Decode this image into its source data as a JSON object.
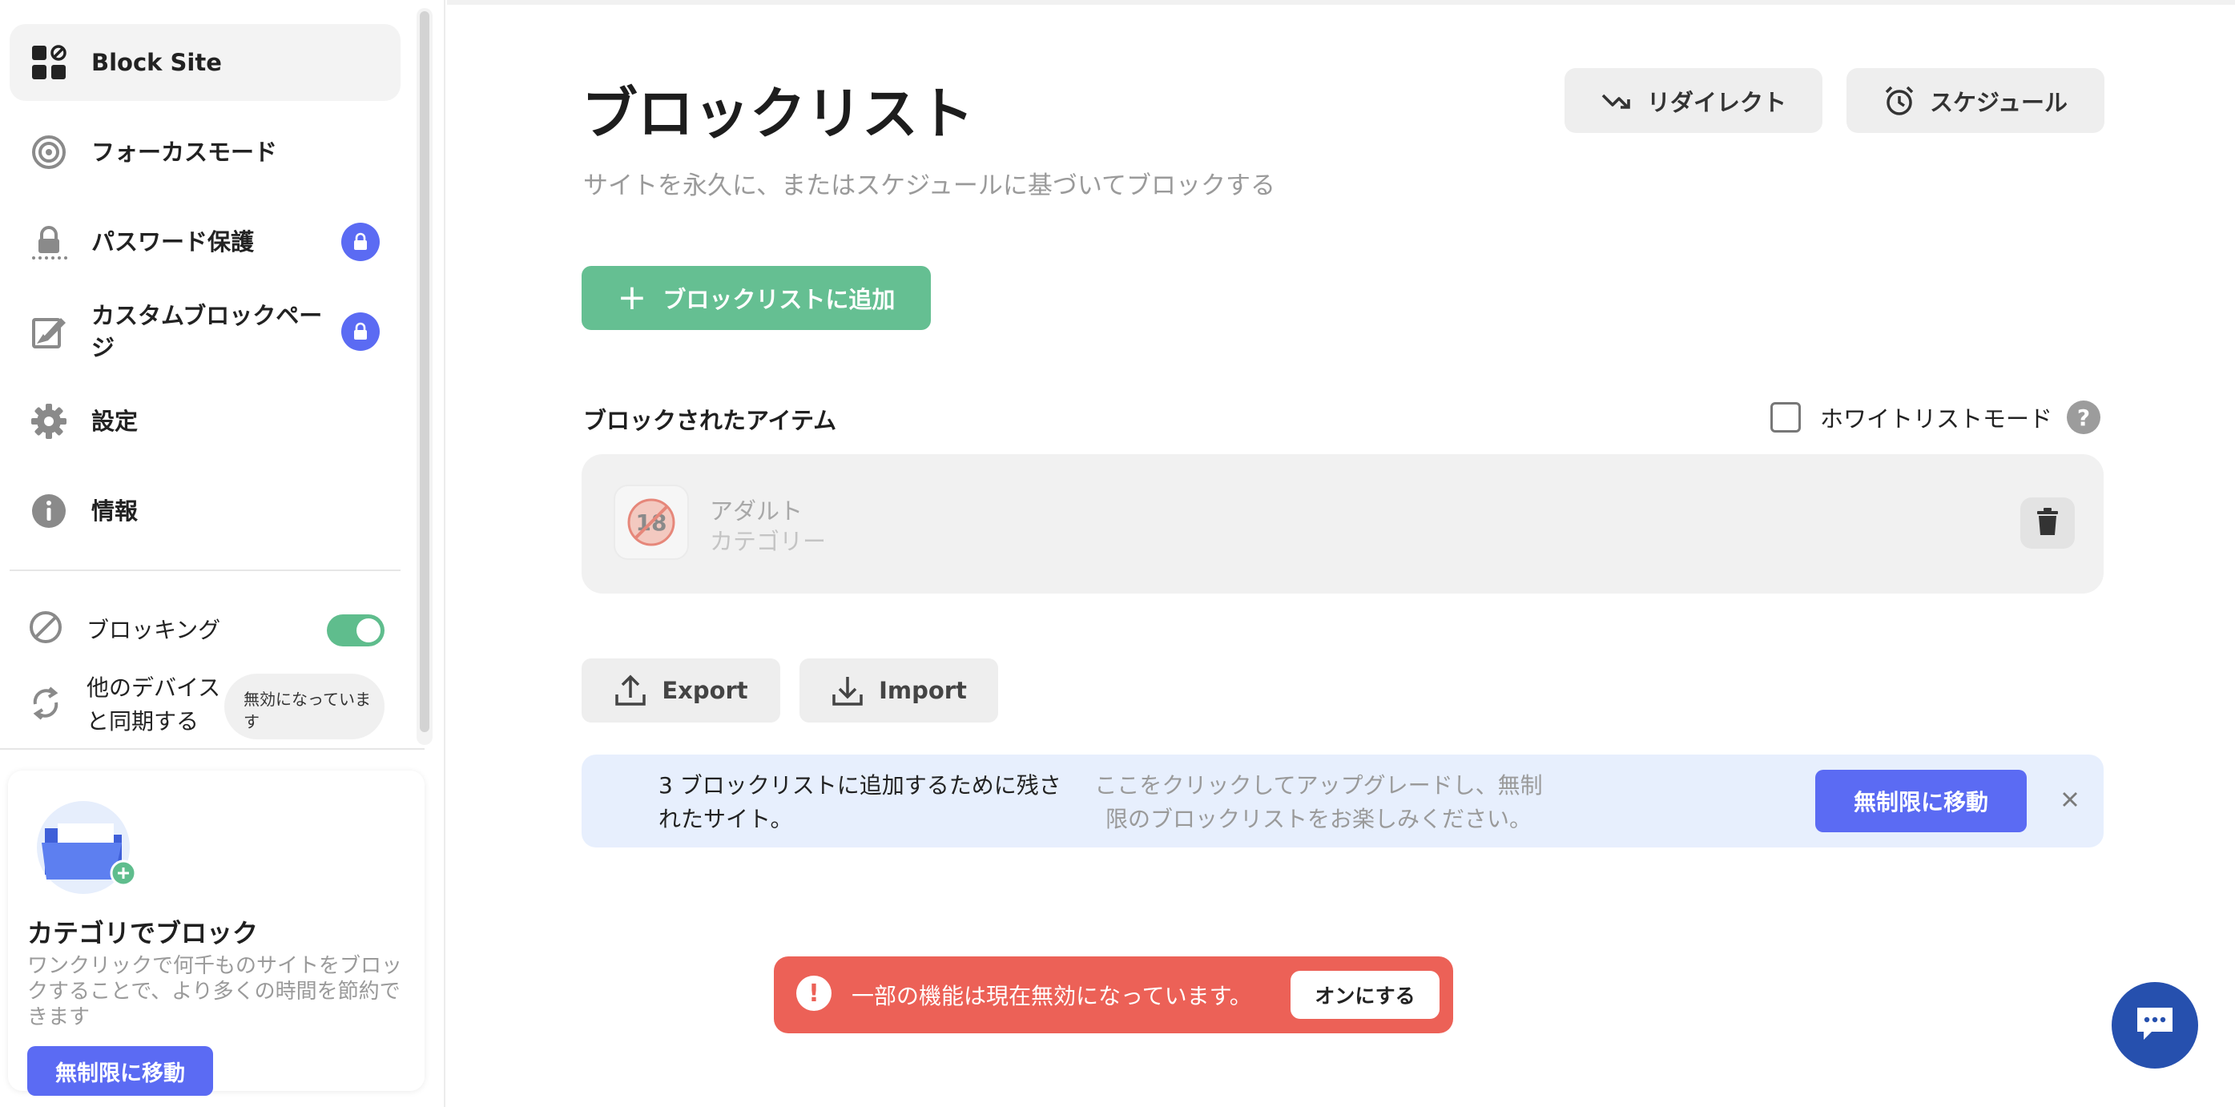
{
  "sidebar": {
    "items": [
      {
        "label": "Block Site",
        "icon": "block-site-logo-icon",
        "active": true,
        "locked": false
      },
      {
        "label": "フォーカスモード",
        "icon": "target-icon",
        "active": false,
        "locked": false
      },
      {
        "label": "パスワード保護",
        "icon": "password-lock-icon",
        "active": false,
        "locked": true
      },
      {
        "label": "カスタムブロックページ",
        "icon": "edit-page-icon",
        "active": false,
        "locked": true
      },
      {
        "label": "設定",
        "icon": "gear-icon",
        "active": false,
        "locked": false
      },
      {
        "label": "情報",
        "icon": "info-icon",
        "active": false,
        "locked": false
      }
    ],
    "blocking": {
      "label": "ブロッキング",
      "enabled": true
    },
    "sync": {
      "label": "他のデバイスと同期する",
      "status": "無効になっています"
    },
    "promo": {
      "title": "カテゴリでブロック",
      "description": "ワンクリックで何千ものサイトをブロックすることで、より多くの時間を節約できます",
      "button": "無制限に移動"
    }
  },
  "main": {
    "title": "ブロックリスト",
    "subtitle": "サイトを永久に、またはスケジュールに基づいてブロックする",
    "redirect_label": "リダイレクト",
    "schedule_label": "スケジュール",
    "add_label": "ブロックリストに追加",
    "blocked_section_title": "ブロックされたアイテム",
    "whitelist_label": "ホワイトリストモード",
    "whitelist_checked": false,
    "blocked_items": [
      {
        "name": "アダルト",
        "type": "カテゴリー",
        "icon": "adult-18-icon"
      }
    ],
    "export_label": "Export",
    "import_label": "Import",
    "banner": {
      "left_text": "3 ブロックリストに追加するために残されたサイト。",
      "mid_text": "ここをクリックしてアップグレードし、無制限のブロックリストをお楽しみください。",
      "button": "無制限に移動"
    },
    "alert": {
      "text": "一部の機能は現在無効になっています。",
      "button": "オンにする"
    }
  },
  "colors": {
    "accent": "#5b6bf3",
    "green": "#65bf92",
    "alert": "#ec6157",
    "chat": "#2650ae",
    "banner_bg": "#e7effd"
  }
}
